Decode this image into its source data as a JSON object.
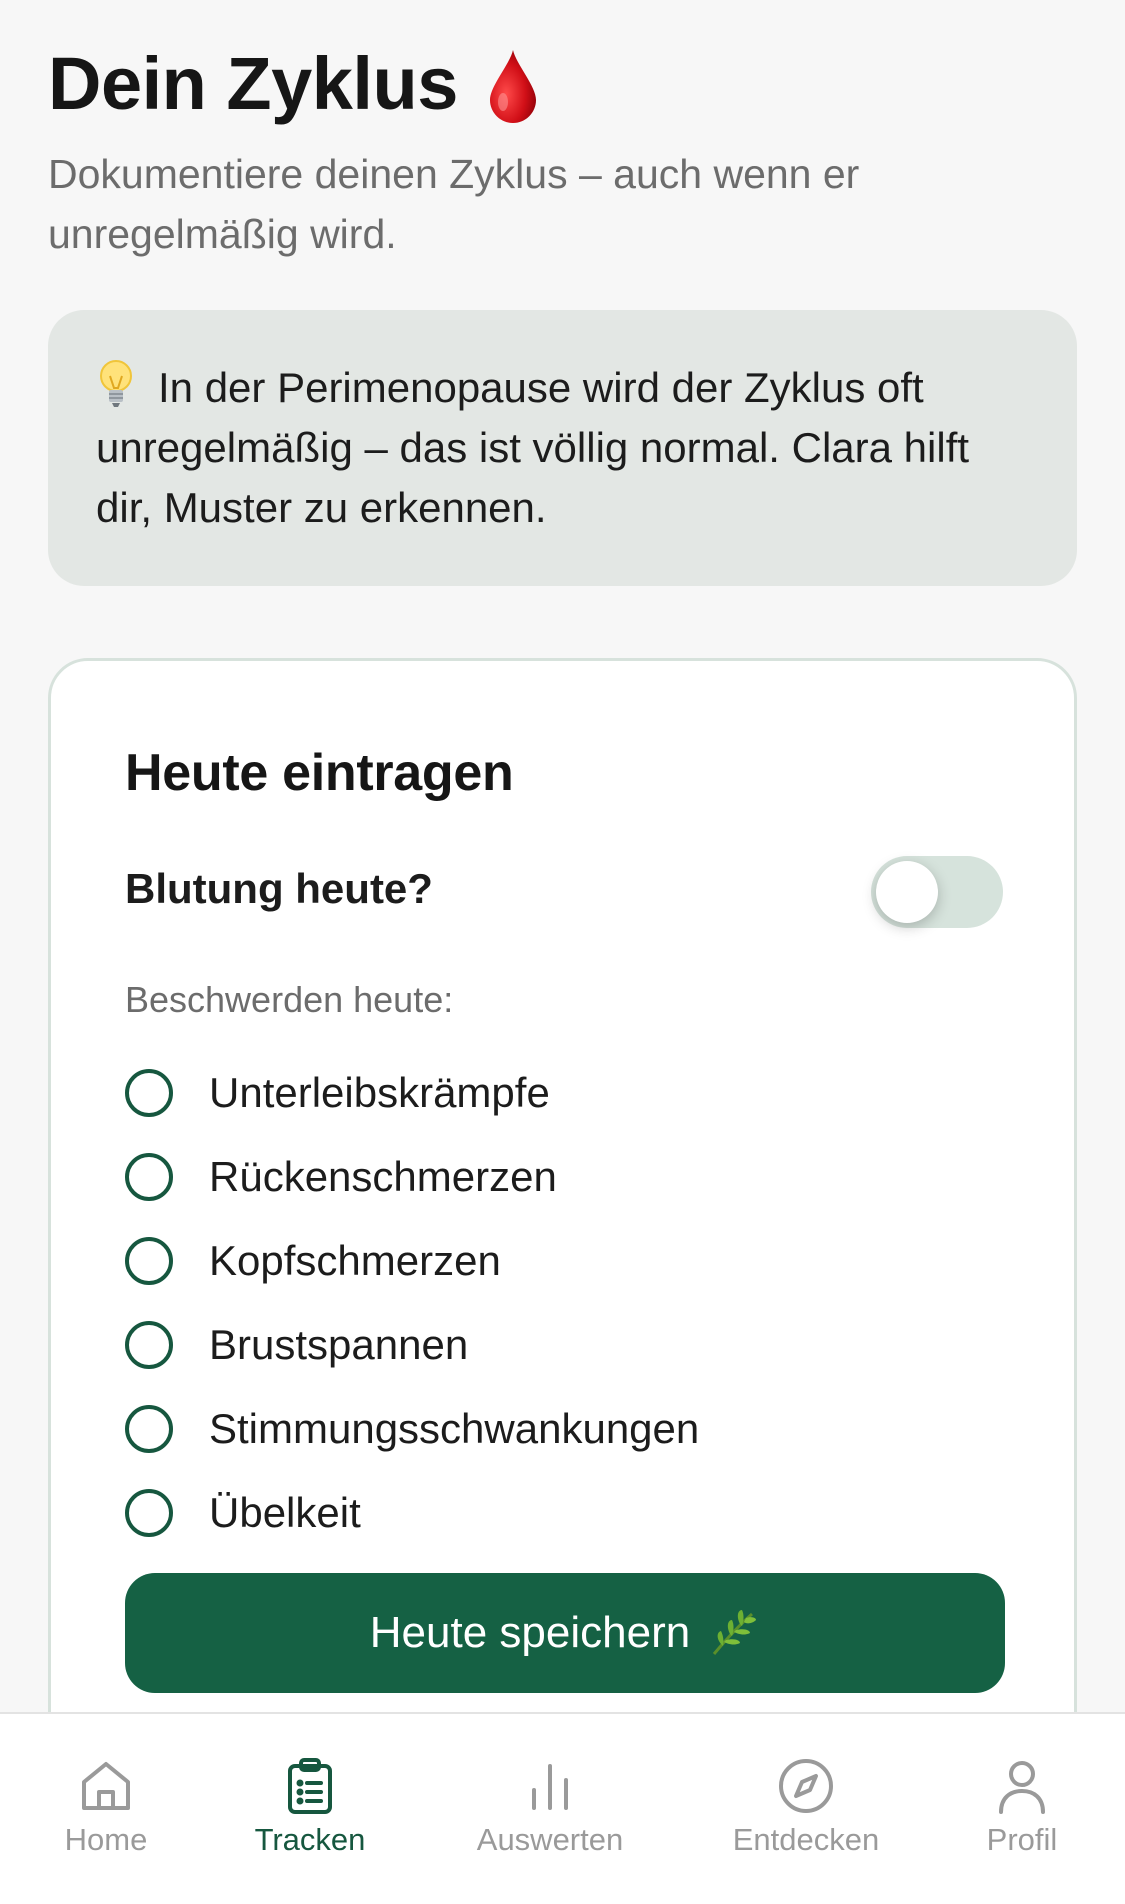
{
  "header": {
    "title": "Dein Zyklus",
    "title_icon": "blood-drop-icon",
    "subtitle": "Dokumentiere deinen Zyklus – auch wenn er unregelmäßig wird."
  },
  "tip": {
    "icon": "light-bulb-icon",
    "text": "In der Perimenopause wird der Zyklus oft unregelmäßig – das ist völlig normal. Clara hilft dir, Muster zu erkennen."
  },
  "entry_card": {
    "title": "Heute eintragen",
    "bleeding_label": "Blutung heute?",
    "bleeding_on": false,
    "complaints_label": "Beschwerden heute:",
    "complaints": [
      {
        "label": "Unterleibskrämpfe",
        "checked": false
      },
      {
        "label": "Rückenschmerzen",
        "checked": false
      },
      {
        "label": "Kopfschmerzen",
        "checked": false
      },
      {
        "label": "Brustspannen",
        "checked": false
      },
      {
        "label": "Stimmungsschwankungen",
        "checked": false
      },
      {
        "label": "Übelkeit",
        "checked": false
      }
    ],
    "save_label": "Heute speichern",
    "save_icon": "herb-leaf-icon"
  },
  "nav": {
    "items": [
      {
        "label": "Home",
        "icon": "home-icon",
        "active": false
      },
      {
        "label": "Tracken",
        "icon": "clipboard-icon",
        "active": true
      },
      {
        "label": "Auswerten",
        "icon": "bar-chart-icon",
        "active": false
      },
      {
        "label": "Entdecken",
        "icon": "compass-icon",
        "active": false
      },
      {
        "label": "Profil",
        "icon": "person-icon",
        "active": false
      }
    ]
  },
  "colors": {
    "primary_green": "#156144",
    "tip_background": "#e3e7e4",
    "page_background": "#f7f7f7",
    "inactive_nav": "#9a9a9a"
  }
}
